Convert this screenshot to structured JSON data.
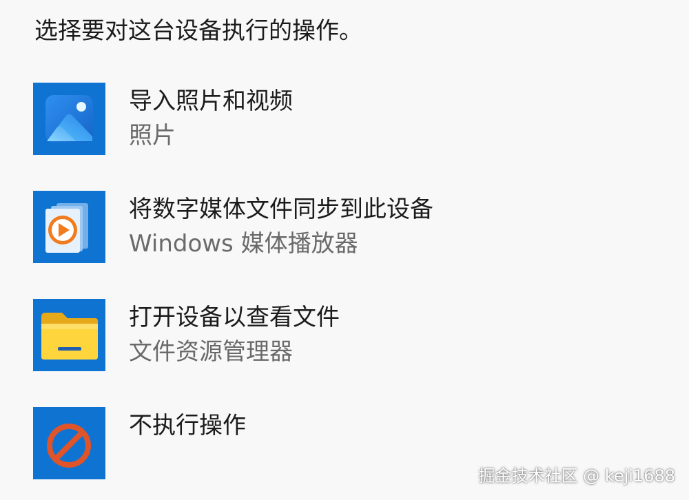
{
  "prompt": "选择要对这台设备执行的操作。",
  "options": [
    {
      "title": "导入照片和视频",
      "subtitle": "照片",
      "icon": "photos-app-icon"
    },
    {
      "title": "将数字媒体文件同步到此设备",
      "subtitle": "Windows 媒体播放器",
      "icon": "windows-media-player-icon"
    },
    {
      "title": "打开设备以查看文件",
      "subtitle": "文件资源管理器",
      "icon": "file-explorer-icon"
    },
    {
      "title": "不执行操作",
      "subtitle": "",
      "icon": "no-action-icon"
    }
  ],
  "watermark": "掘金技术社区 @ keji1688",
  "colors": {
    "tile_background": "#0f73d2",
    "title_text": "#1b1b1b",
    "subtitle_text": "#6a6a6a",
    "page_background": "#f8f8f8"
  }
}
